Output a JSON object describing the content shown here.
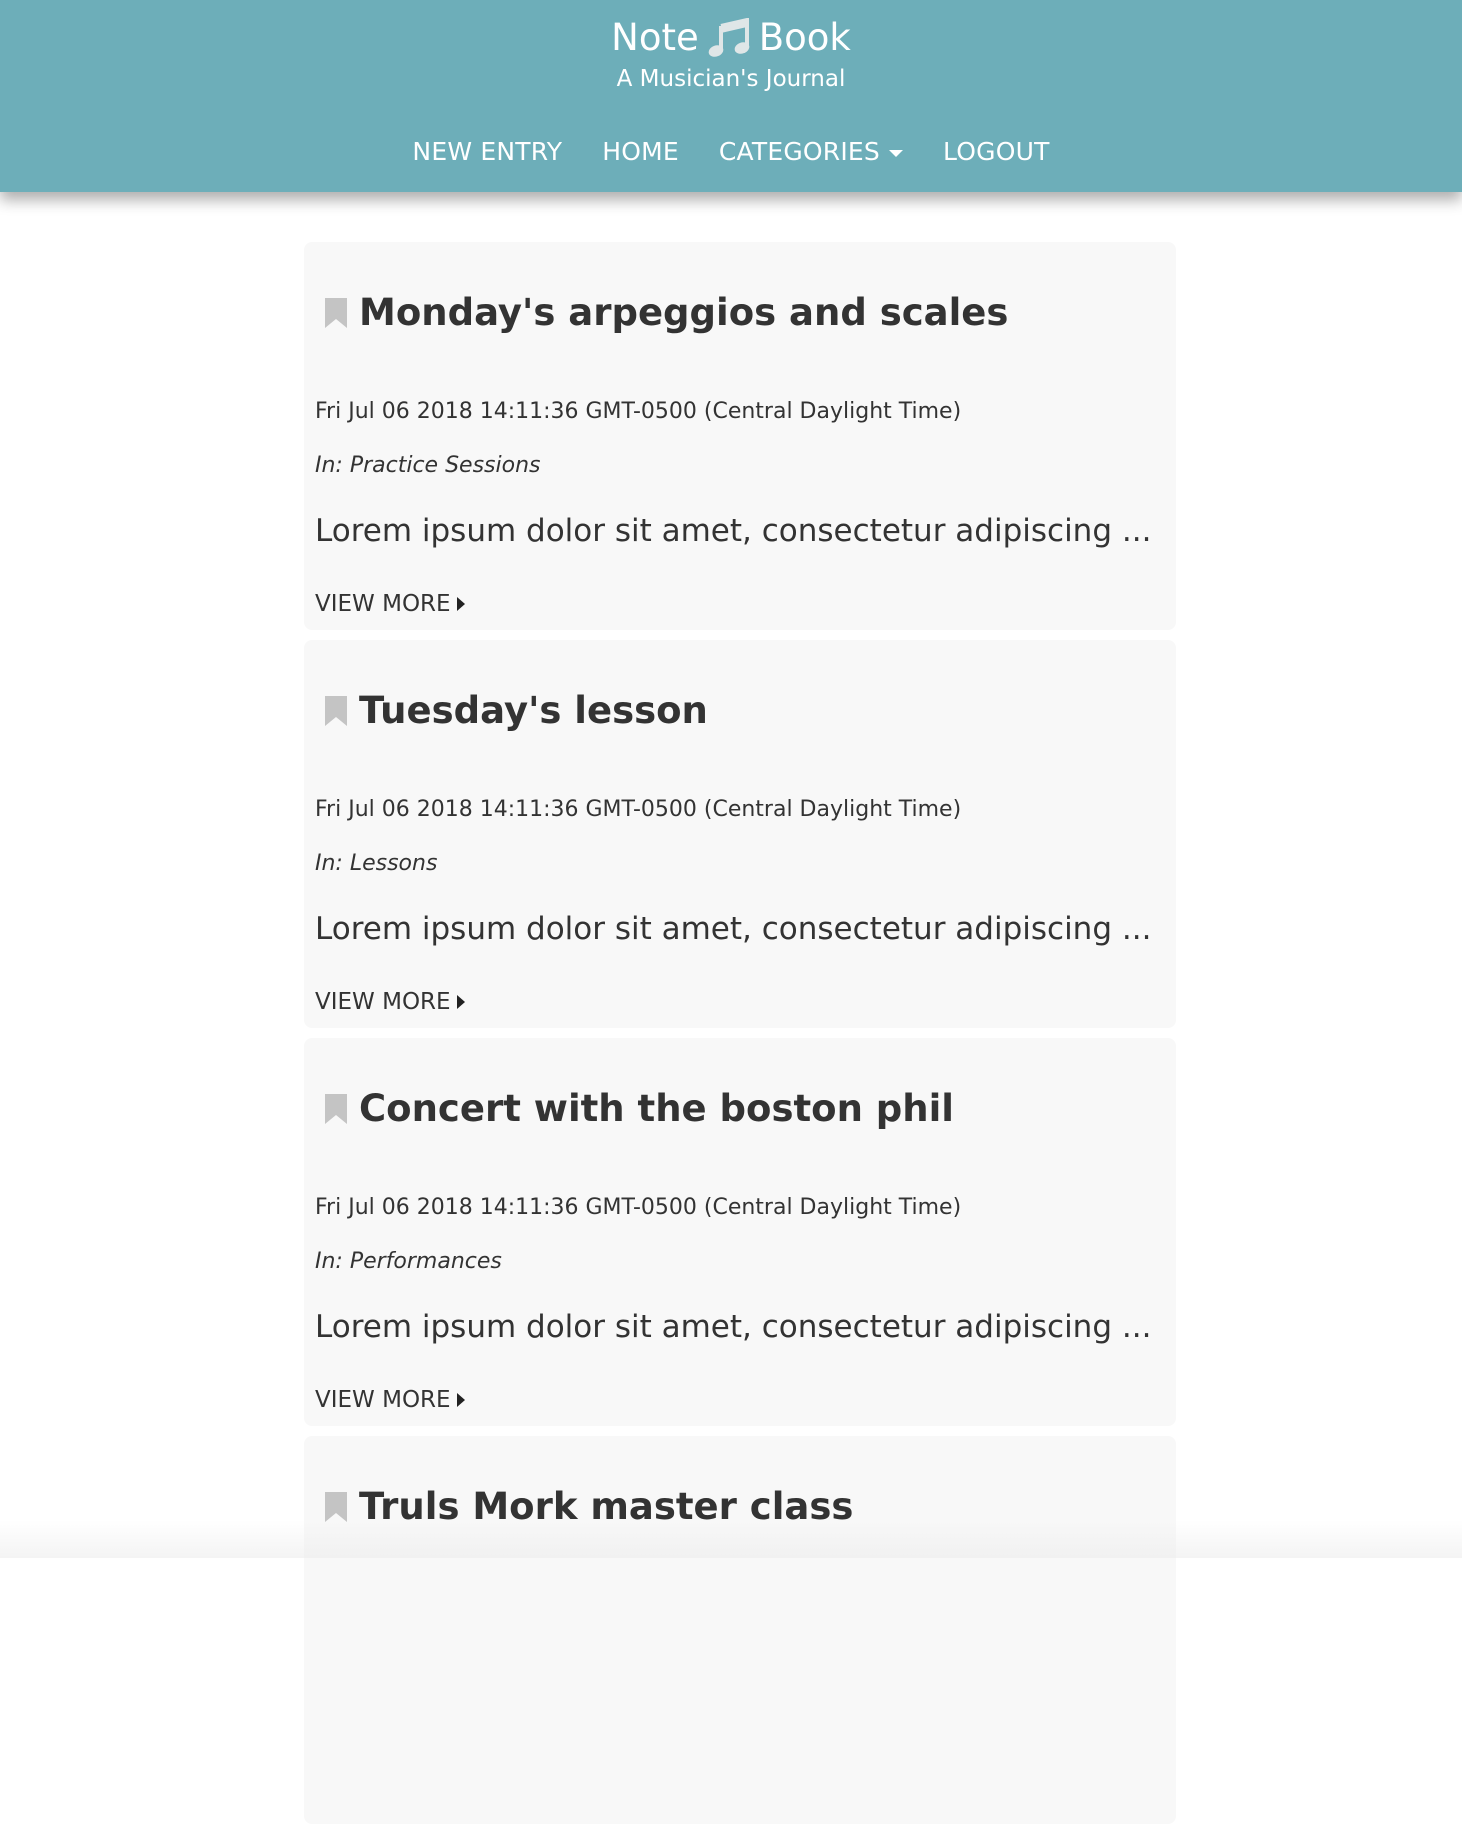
{
  "header": {
    "title_left": "Note",
    "title_right": "Book",
    "title_icon": "music-note-icon",
    "subtitle": "A Musician's Journal",
    "background_color": "#6daeb9"
  },
  "nav": {
    "new_entry": "NEW ENTRY",
    "home": "HOME",
    "categories": "CATEGORIES",
    "logout": "LOGOUT"
  },
  "entries": [
    {
      "title": "Monday's arpeggios and scales",
      "date": "Fri Jul 06 2018 14:11:36 GMT-0500 (Central Daylight Time)",
      "category": "In: Practice Sessions",
      "excerpt": "Lorem ipsum dolor sit amet, consectetur adipiscing ...",
      "more": "VIEW MORE"
    },
    {
      "title": "Tuesday's lesson",
      "date": "Fri Jul 06 2018 14:11:36 GMT-0500 (Central Daylight Time)",
      "category": "In: Lessons",
      "excerpt": "Lorem ipsum dolor sit amet, consectetur adipiscing ...",
      "more": "VIEW MORE"
    },
    {
      "title": "Concert with the boston phil",
      "date": "Fri Jul 06 2018 14:11:36 GMT-0500 (Central Daylight Time)",
      "category": "In: Performances",
      "excerpt": "Lorem ipsum dolor sit amet, consectetur adipiscing ...",
      "more": "VIEW MORE"
    },
    {
      "title": "Truls Mork master class",
      "date": "",
      "category": "",
      "excerpt": "",
      "more": ""
    }
  ],
  "icons": {
    "bookmark": "bookmark-icon",
    "bookmark_color": "#c4c4c4",
    "dropdown": "caret-down-icon",
    "view_more": "caret-right-icon"
  }
}
